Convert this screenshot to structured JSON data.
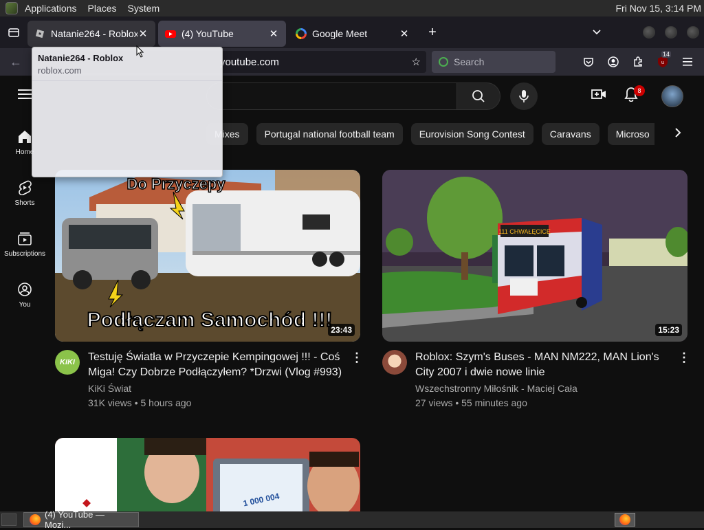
{
  "desktop": {
    "menu": [
      "Applications",
      "Places",
      "System"
    ],
    "clock": "Fri Nov 15,  3:14 PM"
  },
  "browser": {
    "tabs": [
      {
        "title": "Natanie264 - Roblox",
        "icon": "roblox-icon"
      },
      {
        "title": "(4) YouTube",
        "icon": "youtube-icon"
      },
      {
        "title": "Google Meet",
        "icon": "google-meet-icon"
      }
    ],
    "new_tab": "+",
    "url": "youtube.com",
    "search_placeholder": "Search",
    "extension_badge": "14",
    "tooltip": {
      "title": "Natanie264 - Roblox",
      "host": "roblox.com"
    }
  },
  "youtube": {
    "notification_count": "8",
    "sidebar": [
      {
        "label": "Home",
        "icon": "home-icon"
      },
      {
        "label": "Shorts",
        "icon": "shorts-icon"
      },
      {
        "label": "Subscriptions",
        "icon": "subscriptions-icon"
      },
      {
        "label": "You",
        "icon": "you-icon"
      }
    ],
    "chips": [
      "Mixes",
      "Portugal national football team",
      "Eurovision Song Contest",
      "Caravans",
      "Microso"
    ],
    "videos": [
      {
        "thumbnail_text_top": "Do Przyczepy",
        "thumbnail_text_bottom": "Podłączam Samochód !!!",
        "duration": "23:43",
        "title_line1": "Testuję Światła w Przyczepie Kempingowej !!! - Coś",
        "title_line2": "Miga! Czy Dobrze Podłączyłem? *Drzwi (Vlog #993)",
        "channel": "KiKi Świat",
        "stats": "31K views • 5 hours ago",
        "avatar_text": "KiKi"
      },
      {
        "thumbnail_text_top": "111 CHWAŁĘCICE",
        "duration": "15:23",
        "title_line1": "Roblox: Szym's Buses - MAN NM222, MAN Lion's",
        "title_line2": "City 2007 i dwie nowe linie",
        "channel": "Wszechstronny Miłośnik - Maciej Cała",
        "stats": "27 views • 55 minutes ago"
      },
      {
        "thumbnail_text_top": "1 000 004"
      }
    ]
  },
  "taskbar": {
    "task": "(4) YouTube — Mozi..."
  }
}
